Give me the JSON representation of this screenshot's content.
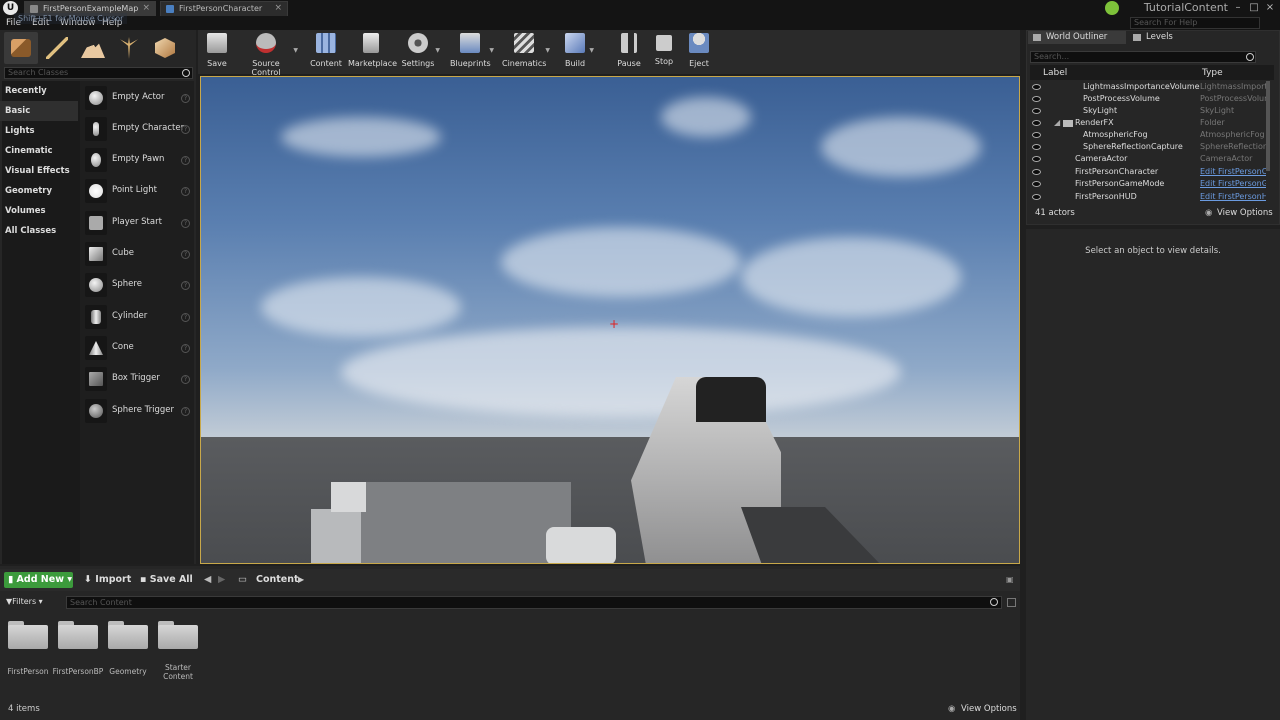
{
  "titlebar": {
    "tabs": [
      {
        "label": "FirstPersonExampleMap"
      },
      {
        "label": "FirstPersonCharacter"
      }
    ],
    "project_name": "TutorialContent",
    "search_help_placeholder": "Search For Help"
  },
  "menu": [
    "File",
    "Edit",
    "Window",
    "Help"
  ],
  "modes": {
    "search_placeholder": "Search Classes",
    "categories": [
      "Recently Placed",
      "Basic",
      "Lights",
      "Cinematic",
      "Visual Effects",
      "Geometry",
      "Volumes",
      "All Classes"
    ],
    "selected_category": "Basic",
    "items": [
      "Empty Actor",
      "Empty Character",
      "Empty Pawn",
      "Point Light",
      "Player Start",
      "Cube",
      "Sphere",
      "Cylinder",
      "Cone",
      "Box Trigger",
      "Sphere Trigger"
    ]
  },
  "toolbar": {
    "buttons": [
      "Save",
      "Source Control",
      "Content",
      "Marketplace",
      "Settings",
      "Blueprints",
      "Cinematics",
      "Build",
      "Pause",
      "Stop",
      "Eject"
    ]
  },
  "viewport": {
    "hint": "Shift+F1 for Mouse Cursor"
  },
  "outliner": {
    "tabs": [
      "World Outliner",
      "Levels"
    ],
    "search_placeholder": "Search...",
    "col_label": "Label",
    "col_type": "Type",
    "rows": [
      {
        "label": "LightmassImportanceVolume",
        "type": "LightmassImportanceVolume"
      },
      {
        "label": "PostProcessVolume",
        "type": "PostProcessVolume"
      },
      {
        "label": "SkyLight",
        "type": "SkyLight"
      },
      {
        "label": "RenderFX",
        "type": "Folder"
      },
      {
        "label": "AtmosphericFog",
        "type": "AtmosphericFog"
      },
      {
        "label": "SphereReflectionCapture",
        "type": "SphereReflectionCapture"
      },
      {
        "label": "CameraActor",
        "type": "CameraActor"
      },
      {
        "label": "FirstPersonCharacter",
        "type": "Edit FirstPersonCharacter"
      },
      {
        "label": "FirstPersonGameMode",
        "type": "Edit FirstPersonGameMode"
      },
      {
        "label": "FirstPersonHUD",
        "type": "Edit FirstPersonHUD"
      }
    ],
    "actor_count": "41 actors",
    "view_options": "View Options"
  },
  "details": {
    "empty_message": "Select an object to view details."
  },
  "content_browser": {
    "add_new": "Add New",
    "import": "Import",
    "save_all": "Save All",
    "path": "Content",
    "filters": "Filters",
    "search_placeholder": "Search Content",
    "folders": [
      "FirstPerson",
      "FirstPersonBP",
      "Geometry",
      "Starter Content"
    ],
    "item_count": "4 items",
    "view_options": "View Options"
  },
  "colors": {
    "accent_green": "#3c9b3c",
    "viewport_border": "#c8a84a",
    "link_blue": "#6b9be0"
  }
}
